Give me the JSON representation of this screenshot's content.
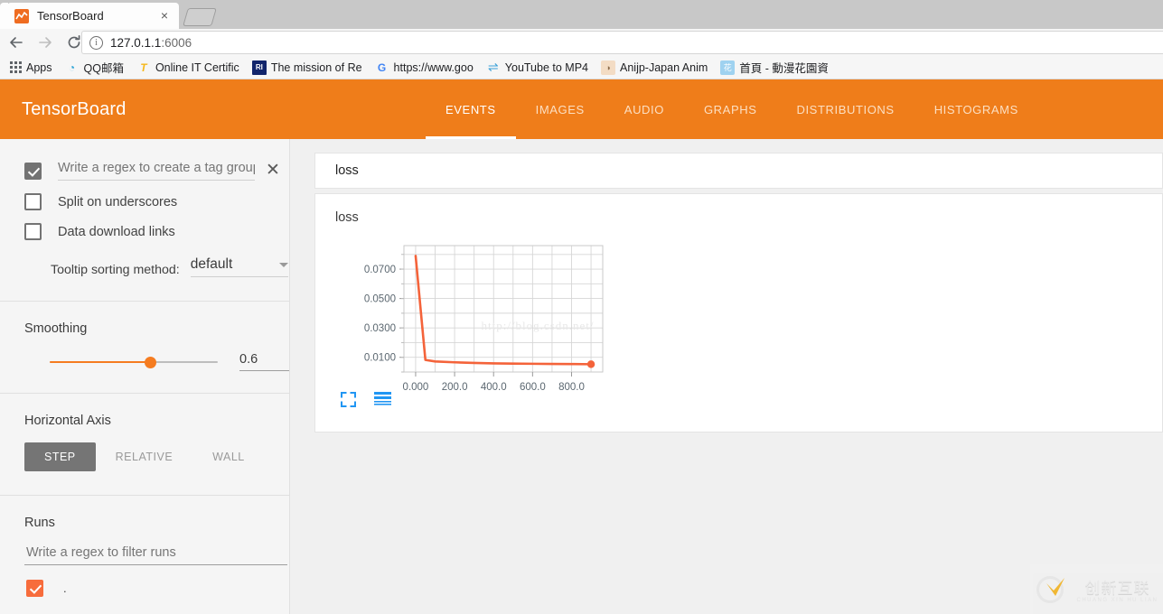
{
  "browser": {
    "tab": {
      "title": "TensorBoard",
      "favicon": "chart-favicon",
      "close_label": "×"
    },
    "newtab_label": "+",
    "nav": {
      "back": "←",
      "forward": "→",
      "reload": "⟳"
    },
    "omnibox": {
      "host": "127.0.1.1",
      "port": ":6006",
      "info_glyph": "i"
    },
    "bookmarks": [
      {
        "label": "Apps",
        "icon": "apps-grid-icon",
        "glyph": ""
      },
      {
        "label": "QQ邮箱",
        "icon": "qq-mail-icon",
        "glyph": "◔"
      },
      {
        "label": "Online IT Certific",
        "icon": "letter-t-icon",
        "glyph": "T"
      },
      {
        "label": "The mission of Re",
        "icon": "ri-icon",
        "glyph": "RI"
      },
      {
        "label": "https://www.goo",
        "icon": "google-icon",
        "glyph": "G"
      },
      {
        "label": "YouTube to MP4",
        "icon": "convert-icon",
        "glyph": "⇌"
      },
      {
        "label": "Anijp-Japan Anim",
        "icon": "anime-icon",
        "glyph": "◑"
      },
      {
        "label": "首頁 - 動漫花園資",
        "icon": "hana-icon",
        "glyph": "花"
      }
    ]
  },
  "tensorboard": {
    "brand": "TensorBoard",
    "accent_color": "#ef7d1a",
    "tabs": [
      {
        "label": "EVENTS",
        "active": true
      },
      {
        "label": "IMAGES",
        "active": false
      },
      {
        "label": "AUDIO",
        "active": false
      },
      {
        "label": "GRAPHS",
        "active": false
      },
      {
        "label": "DISTRIBUTIONS",
        "active": false
      },
      {
        "label": "HISTOGRAMS",
        "active": false
      }
    ]
  },
  "sidebar": {
    "tag_group": {
      "checked": true,
      "placeholder": "Write a regex to create a tag group",
      "value": "",
      "clear_label": "✕"
    },
    "options": [
      {
        "label": "Split on underscores",
        "checked": false
      },
      {
        "label": "Data download links",
        "checked": false
      }
    ],
    "tooltip": {
      "label": "Tooltip sorting method:",
      "value": "default"
    },
    "smoothing": {
      "title": "Smoothing",
      "value": "0.6",
      "slider_percent": 60
    },
    "horizontal_axis": {
      "title": "Horizontal Axis",
      "options": [
        {
          "label": "STEP",
          "active": true
        },
        {
          "label": "RELATIVE",
          "active": false
        },
        {
          "label": "WALL",
          "active": false
        }
      ]
    },
    "runs": {
      "title": "Runs",
      "filter_placeholder": "Write a regex to filter runs",
      "filter_value": "",
      "items": [
        {
          "label": ".",
          "checked": true,
          "color": "#f76c3c"
        }
      ]
    }
  },
  "main": {
    "search": {
      "value": "loss",
      "placeholder": ""
    },
    "card": {
      "title": "loss",
      "expand_icon": "fullscreen-icon",
      "series_icon": "data-series-icon",
      "icon_color": "#2196f3"
    },
    "watermark": {
      "url": "http://blog.csdn.net/",
      "logo_cn": "创新互联",
      "logo_py": "CHUANG XIN HU LIAN"
    }
  },
  "chart_data": {
    "type": "line",
    "title": "loss",
    "xlabel": "",
    "ylabel": "",
    "grid": true,
    "legend": "none",
    "line_color": "#f4633a",
    "xlim": [
      -60,
      960
    ],
    "ylim": [
      0.0,
      0.086
    ],
    "xticks": [
      "0.000",
      "200.0",
      "400.0",
      "600.0",
      "800.0"
    ],
    "xtick_values": [
      0,
      200,
      400,
      600,
      800
    ],
    "yticks": [
      "0.0100",
      "0.0300",
      "0.0500",
      "0.0700"
    ],
    "ytick_values": [
      0.01,
      0.03,
      0.05,
      0.07
    ],
    "series": [
      {
        "name": "loss",
        "x": [
          0,
          50,
          100,
          200,
          300,
          400,
          500,
          600,
          700,
          800,
          900
        ],
        "y": [
          0.079,
          0.0082,
          0.0072,
          0.0066,
          0.0062,
          0.0059,
          0.0057,
          0.0056,
          0.0055,
          0.0054,
          0.0053
        ],
        "last_point_marker": true
      }
    ]
  }
}
